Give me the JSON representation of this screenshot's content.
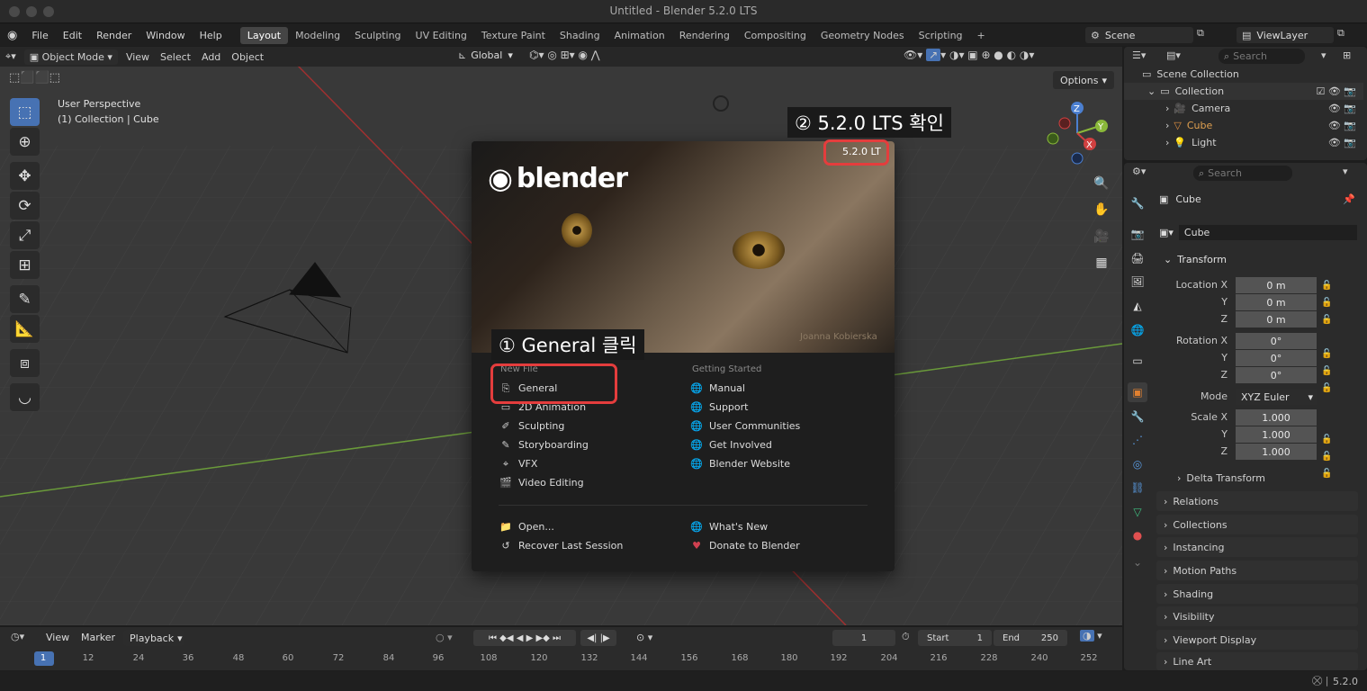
{
  "window": {
    "title": "Untitled - Blender 5.2.0 LTS"
  },
  "menu": [
    "File",
    "Edit",
    "Render",
    "Window",
    "Help"
  ],
  "workspaces": [
    "Layout",
    "Modeling",
    "Sculpting",
    "UV Editing",
    "Texture Paint",
    "Shading",
    "Animation",
    "Rendering",
    "Compositing",
    "Geometry Nodes",
    "Scripting"
  ],
  "workspace_add": "+",
  "scene": {
    "name": "Scene",
    "view_layer": "ViewLayer"
  },
  "viewport": {
    "mode": "Object Mode",
    "menus": [
      "View",
      "Select",
      "Add",
      "Object"
    ],
    "transform_orientation": "Global",
    "options_label": "Options",
    "perspective": "User Perspective",
    "context": "(1) Collection | Cube"
  },
  "splash": {
    "logo": "blender",
    "version": "5.2.0 LT",
    "artist": "Joanna Kobierska",
    "new_file_header": "New File",
    "new_file": [
      "General",
      "2D Animation",
      "Sculpting",
      "Storyboarding",
      "VFX",
      "Video Editing"
    ],
    "getting_started_header": "Getting Started",
    "getting_started": [
      "Manual",
      "Support",
      "User Communities",
      "Get Involved",
      "Blender Website"
    ],
    "open": "Open...",
    "recover": "Recover Last Session",
    "whats_new": "What's New",
    "donate": "Donate to Blender"
  },
  "annotations": {
    "step1": "① General 클릭",
    "step2": "② 5.2.0 LTS 확인"
  },
  "outliner": {
    "search_placeholder": "Search",
    "scene_collection": "Scene Collection",
    "items": [
      "Collection",
      "Camera",
      "Cube",
      "Light"
    ]
  },
  "properties": {
    "search_placeholder": "Search",
    "object_name": "Cube",
    "object_data": "Cube",
    "transform_header": "Transform",
    "location_label": "Location X",
    "rotation_label": "Rotation X",
    "scale_label": "Scale X",
    "axis_y": "Y",
    "axis_z": "Z",
    "location": [
      "0 m",
      "0 m",
      "0 m"
    ],
    "rotation": [
      "0°",
      "0°",
      "0°"
    ],
    "mode_label": "Mode",
    "mode_value": "XYZ Euler",
    "scale": [
      "1.000",
      "1.000",
      "1.000"
    ],
    "delta_transform": "Delta Transform",
    "sections": [
      "Relations",
      "Collections",
      "Instancing",
      "Motion Paths",
      "Shading",
      "Visibility",
      "Viewport Display",
      "Line Art"
    ]
  },
  "timeline": {
    "menus": [
      "View",
      "Marker",
      "Playback"
    ],
    "current_frame": "1",
    "start_label": "Start",
    "start": "1",
    "end_label": "End",
    "end": "250",
    "frames": [
      "1",
      "12",
      "24",
      "36",
      "48",
      "60",
      "72",
      "84",
      "96",
      "108",
      "120",
      "132",
      "144",
      "156",
      "168",
      "180",
      "192",
      "204",
      "216",
      "228",
      "240",
      "252"
    ]
  },
  "status": {
    "version": "5.2.0"
  }
}
